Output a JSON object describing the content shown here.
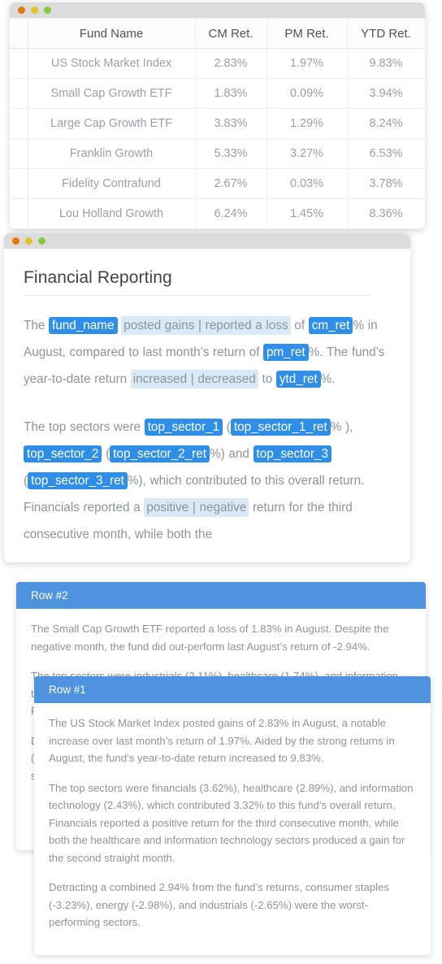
{
  "window_chrome": {
    "dots": [
      "close-dot",
      "minimize-dot",
      "maximize-dot"
    ],
    "colors": {
      "red": "#e8760f",
      "yellow": "#dfc527",
      "green": "#8cc63f"
    }
  },
  "fund_table": {
    "columns": [
      "Fund Name",
      "CM Ret.",
      "PM Ret.",
      "YTD Ret."
    ],
    "rows": [
      {
        "fund_name": "US Stock Market Index",
        "cm_ret": "2.83%",
        "pm_ret": "1.97%",
        "ytd_ret": "9.83%"
      },
      {
        "fund_name": "Small Cap Growth ETF",
        "cm_ret": "1.83%",
        "pm_ret": "0.09%",
        "ytd_ret": "3.94%"
      },
      {
        "fund_name": "Large Cap Growth ETF",
        "cm_ret": "3.83%",
        "pm_ret": "1.29%",
        "ytd_ret": "8.24%"
      },
      {
        "fund_name": "Franklin Growth",
        "cm_ret": "5.33%",
        "pm_ret": "3.27%",
        "ytd_ret": "6.53%"
      },
      {
        "fund_name": "Fidelity Contrafund",
        "cm_ret": "2.67%",
        "pm_ret": "0.03%",
        "ytd_ret": "3.78%"
      },
      {
        "fund_name": "Lou Holland Growth",
        "cm_ret": "6.24%",
        "pm_ret": "1.45%",
        "ytd_ret": "8.36%"
      }
    ]
  },
  "template_doc": {
    "title": "Financial Reporting",
    "paragraph1": {
      "t1": "The ",
      "var_fund_name": "fund_name",
      "cond_gains_loss": "posted gains | reported a loss",
      "t2": " of ",
      "var_cm_ret": "cm_ret",
      "t3": "% in August, compared to last month’s return of ",
      "var_pm_ret": "pm_ret",
      "t4": "%. The fund’s year-to-date return ",
      "cond_inc_dec": "increased | decreased",
      "t5": " to ",
      "var_ytd_ret": "ytd_ret",
      "t6": "%."
    },
    "paragraph2": {
      "t1": "The top sectors were ",
      "var_sector1": "top_sector_1",
      "t2": " (",
      "var_sector1_ret": "top_sector_1_ret",
      "t3": "% ), ",
      "var_sector2": "top_sector_2",
      "t4": " (",
      "var_sector2_ret": "top_sector_2_ret",
      "t5": "%) and ",
      "var_sector3": "top_sector_3",
      "t6": " (",
      "var_sector3_ret": "top_sector_3_ret",
      "t7": "%), which contributed to this overall return. Financials reported a ",
      "cond_pos_neg": "positive | negative",
      "t8": " return for the third consecutive month, while both the"
    }
  },
  "cards": {
    "row2": {
      "header": "Row #2",
      "paragraphs": [
        "The Small Cap Growth ETF reported a loss of 1.83% in August. Despite the negative month, the fund did out-perform last August’s return of -2.94%.",
        "The top sectors were industrials (2.11%), healthcare (1.74%), and information technology (1.52%), which contributed 1.21% to this fund’s overall return. Financials reported a negative return for the third consecutive month.",
        "Detracting a combined 2.41% from the fund’s returns, consumer staples (-2.88%), energy (-2.14%), and materials (-1.97%) were the worst-performing sectors."
      ]
    },
    "row1": {
      "header": "Row #1",
      "paragraphs": [
        "The US Stock Market Index posted gains of 2.83% in August, a notable increase over last month’s return of 1.97%. Aided by the strong returns in August, the fund’s year-to-date return increased to 9.83%.",
        "The top sectors were financials (3.62%), healthcare (2.89%), and information technology (2.43%), which contributed 3.32% to this fund’s overall return. Financials reported a positive return for the third consecutive month, while both the healthcare and information technology sectors produced a gain for the second straight month.",
        "Detracting a combined 2.94% from the fund’s returns, consumer staples (-3.23%), energy (-2.98%), and industrials (-2.65%) were the worst-performing sectors."
      ]
    }
  }
}
